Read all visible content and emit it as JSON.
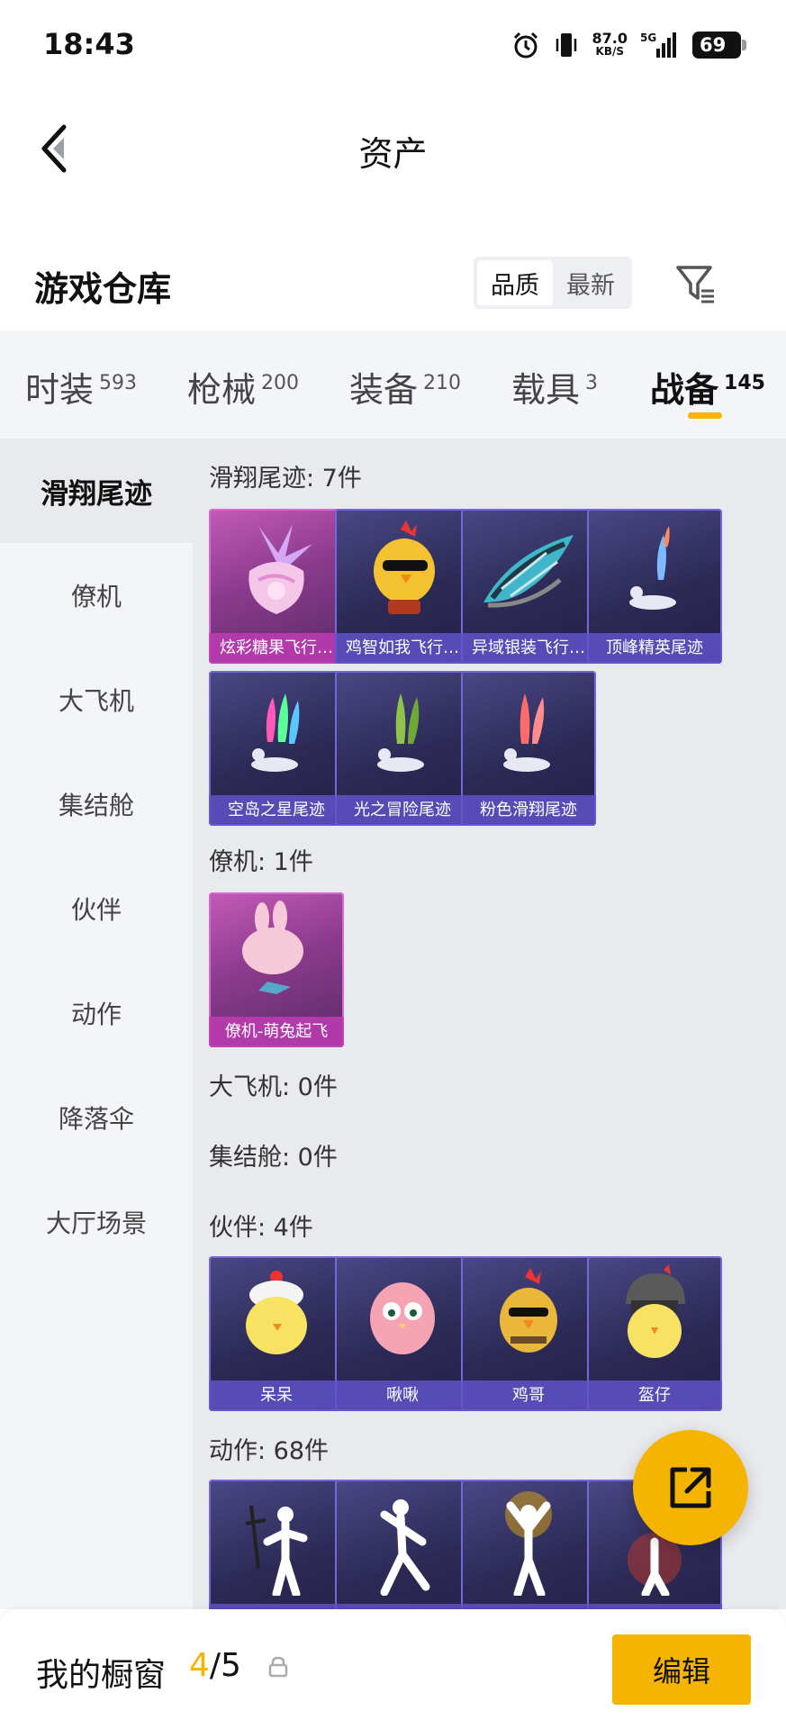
{
  "status_bar": {
    "time": "18:43",
    "speed": "87.0",
    "speed_unit": "KB/S",
    "network": "5G",
    "battery": "69"
  },
  "nav": {
    "title": "资产"
  },
  "warehouse": {
    "title": "游戏仓库",
    "sort_options": [
      "品质",
      "最新"
    ],
    "sort_selected": "品质"
  },
  "tabs": [
    {
      "label": "时装",
      "count": "593"
    },
    {
      "label": "枪械",
      "count": "200"
    },
    {
      "label": "装备",
      "count": "210"
    },
    {
      "label": "载具",
      "count": "3"
    },
    {
      "label": "战备",
      "count": "145"
    }
  ],
  "active_tab": "战备",
  "sidebar": {
    "items": [
      "滑翔尾迹",
      "僚机",
      "大飞机",
      "集结舱",
      "伙伴",
      "动作",
      "降落伞",
      "大厅场景"
    ],
    "active": "滑翔尾迹"
  },
  "sections": [
    {
      "title": "滑翔尾迹: 7件",
      "items": [
        "炫彩糖果飞行…",
        "鸡智如我飞行…",
        "异域银装飞行…",
        "顶峰精英尾迹",
        "空岛之星尾迹",
        "光之冒险尾迹",
        "粉色滑翔尾迹"
      ]
    },
    {
      "title": "僚机: 1件",
      "items": [
        "僚机-萌兔起飞"
      ]
    },
    {
      "title": "大飞机: 0件",
      "items": []
    },
    {
      "title": "集结舱: 0件",
      "items": []
    },
    {
      "title": "伙伴: 4件",
      "items": [
        "呆呆",
        "啾啾",
        "鸡哥",
        "盔仔"
      ]
    },
    {
      "title": "动作: 68件",
      "items": [
        "",
        "",
        "",
        ""
      ]
    }
  ],
  "bottom": {
    "shop_label": "我的橱窗",
    "used": "4",
    "total": "/5",
    "edit_label": "编辑"
  },
  "colors": {
    "accent": "#f5b400",
    "card_purple": "#2c2a55",
    "card_pink": "#8b3b8d"
  }
}
